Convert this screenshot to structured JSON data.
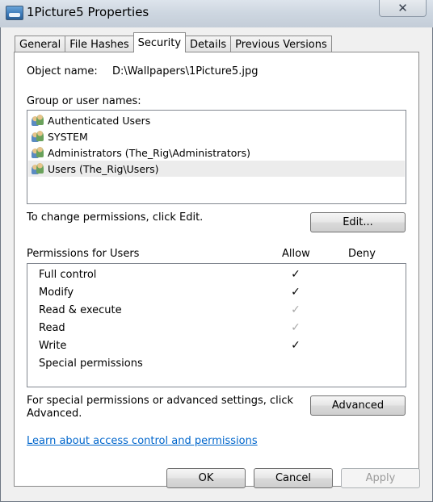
{
  "window": {
    "title": "1Picture5 Properties",
    "close_glyph": "✕"
  },
  "tabs": [
    {
      "label": "General",
      "active": false
    },
    {
      "label": "File Hashes",
      "active": false
    },
    {
      "label": "Security",
      "active": true
    },
    {
      "label": "Details",
      "active": false
    },
    {
      "label": "Previous Versions",
      "active": false
    }
  ],
  "security": {
    "object_name_label": "Object name:",
    "object_name_value": "D:\\Wallpapers\\1Picture5.jpg",
    "group_label": "Group or user names:",
    "users": [
      {
        "name": "Authenticated Users",
        "icon": "users-icon",
        "selected": false
      },
      {
        "name": "SYSTEM",
        "icon": "users-icon",
        "selected": false
      },
      {
        "name": "Administrators (The_Rig\\Administrators)",
        "icon": "users-icon",
        "selected": false
      },
      {
        "name": "Users (The_Rig\\Users)",
        "icon": "users-icon",
        "selected": true
      }
    ],
    "change_text": "To change permissions, click Edit.",
    "edit_button": "Edit...",
    "permissions_header": "Permissions for Users",
    "allow_header": "Allow",
    "deny_header": "Deny",
    "permissions": [
      {
        "name": "Full control",
        "allow": "✓",
        "allow_state": "on",
        "deny": ""
      },
      {
        "name": "Modify",
        "allow": "✓",
        "allow_state": "on",
        "deny": ""
      },
      {
        "name": "Read & execute",
        "allow": "✓",
        "allow_state": "inherited",
        "deny": ""
      },
      {
        "name": "Read",
        "allow": "✓",
        "allow_state": "inherited",
        "deny": ""
      },
      {
        "name": "Write",
        "allow": "✓",
        "allow_state": "on",
        "deny": ""
      },
      {
        "name": "Special permissions",
        "allow": "",
        "allow_state": "none",
        "deny": ""
      }
    ],
    "special_text_line1": "For special permissions or advanced settings, click",
    "special_text_line2": "Advanced.",
    "advanced_button": "Advanced",
    "learn_link": "Learn about access control and permissions"
  },
  "footer": {
    "ok": "OK",
    "cancel": "Cancel",
    "apply": "Apply"
  },
  "colors": {
    "link": "#0066cc",
    "selection": "#ececec",
    "check_on": "#000000",
    "check_inherited": "#a8a8a8"
  }
}
